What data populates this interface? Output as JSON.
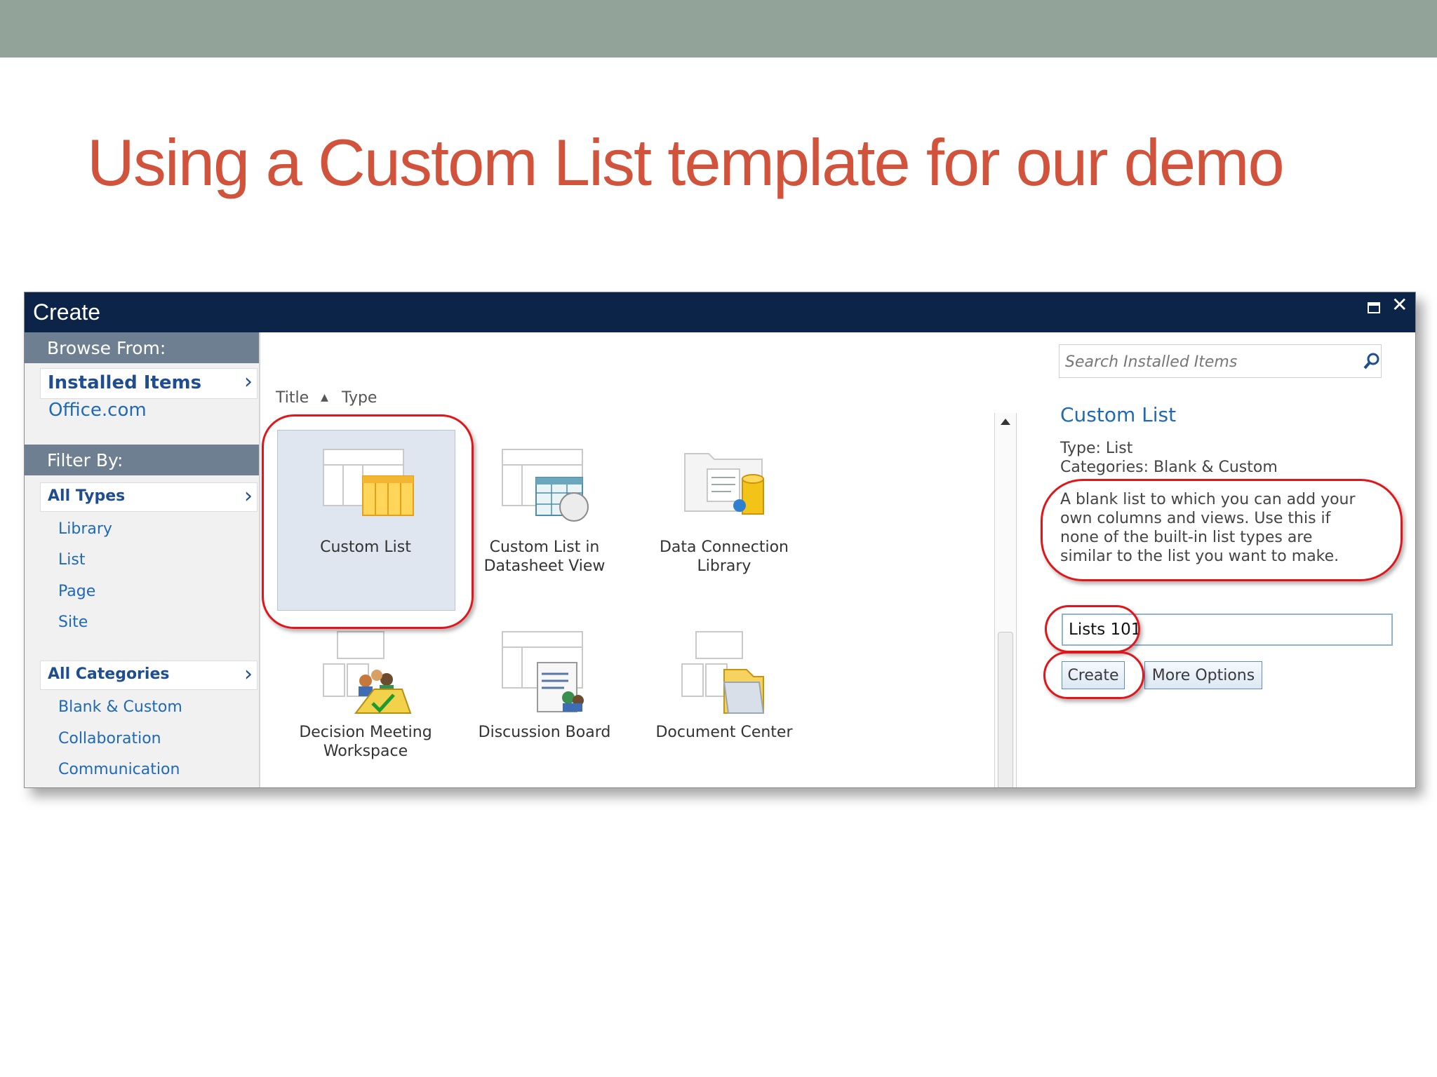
{
  "slide": {
    "title": "Using a Custom List template for our demo"
  },
  "dialog": {
    "title": "Create",
    "nav": {
      "browse_heading": "Browse From:",
      "browse_selected": "Installed Items",
      "browse_links": [
        "Office.com"
      ],
      "filter_heading": "Filter By:",
      "types_selected": "All Types",
      "types": [
        "Library",
        "List",
        "Page",
        "Site"
      ],
      "categories_selected": "All Categories",
      "categories": [
        "Blank & Custom",
        "Collaboration",
        "Communication"
      ]
    },
    "sort": {
      "title": "Title",
      "type": "Type"
    },
    "tiles": [
      {
        "line1": "Custom List",
        "line2": ""
      },
      {
        "line1": "Custom List in",
        "line2": "Datasheet View"
      },
      {
        "line1": "Data Connection",
        "line2": "Library"
      },
      {
        "line1": "Decision Meeting",
        "line2": "Workspace"
      },
      {
        "line1": "Discussion Board",
        "line2": ""
      },
      {
        "line1": "Document Center",
        "line2": ""
      }
    ],
    "panel": {
      "search_placeholder": "Search Installed Items",
      "selected_title": "Custom List",
      "type_line": "Type: List",
      "categories_line": "Categories: Blank & Custom",
      "description": "A blank list to which you can add your own columns and views. Use this if none of the built-in list types are similar to the list you want to make.",
      "name_value": "Lists 101",
      "create_label": "Create",
      "more_options_label": "More Options"
    }
  },
  "colors": {
    "accent": "#d2533b",
    "titlebar": "#0b2447",
    "link": "#1f69b6",
    "highlight_circle": "#e1161b"
  }
}
